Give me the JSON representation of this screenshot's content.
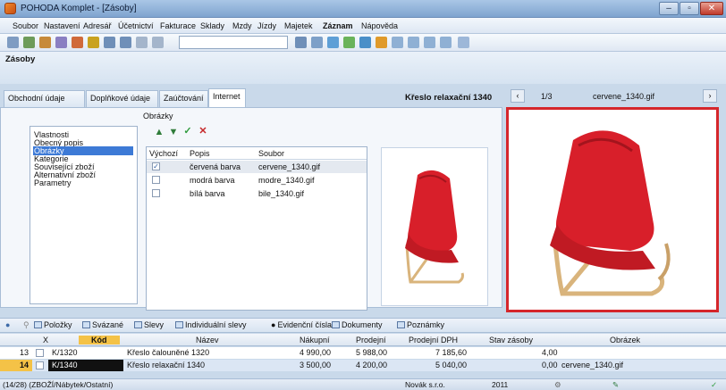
{
  "window": {
    "title": "POHODA Komplet - [Zásoby]",
    "controls": [
      "minimize-icon",
      "maximize-icon",
      "close-icon"
    ]
  },
  "menu": [
    "Soubor",
    "Nastavení",
    "Adresář",
    "Účetnictví",
    "Fakturace",
    "Sklady",
    "Mzdy",
    "Jízdy",
    "Majetek",
    "Záznam",
    "Nápověda"
  ],
  "section": {
    "title": "Zásoby"
  },
  "tabs": [
    "Obchodní údaje",
    "Doplňkové údaje",
    "Zaúčtování",
    "Internet"
  ],
  "active_tab": "Internet",
  "product": {
    "name": "Křeslo relaxační 1340",
    "position": "1/3",
    "file": "cervene_1340.gif"
  },
  "left_list": {
    "items": [
      "Vlastnosti",
      "Obecný popis",
      "Obrázky",
      "Kategorie",
      "Související zboží",
      "Alternativní zboží",
      "Parametry"
    ],
    "selected": "Obrázky"
  },
  "images_group": {
    "label": "Obrázky",
    "toolbar_icons": [
      "arrow-up-icon",
      "arrow-down-icon",
      "check-icon",
      "delete-icon"
    ],
    "columns": [
      "Výchozí",
      "Popis",
      "Soubor"
    ],
    "rows": [
      {
        "default": true,
        "description": "červená barva",
        "file": "cervene_1340.gif"
      },
      {
        "default": false,
        "description": "modrá barva",
        "file": "modre_1340.gif"
      },
      {
        "default": false,
        "description": "bílá barva",
        "file": "bile_1340.gif"
      }
    ]
  },
  "bottom_tabs": [
    "Položky",
    "Svázané",
    "Slevy",
    "Individuální slevy",
    "Evidenční čísla",
    "Dokumenty",
    "Poznámky"
  ],
  "grid": {
    "columns": [
      "X",
      "Kód",
      "Název",
      "Nákupní",
      "Prodejní",
      "Prodejní DPH",
      "Stav zásoby",
      "Obrázek"
    ],
    "rows": [
      {
        "num": "13",
        "code": "K/1320",
        "name": "Křeslo čalouněné 1320",
        "purchase": "4 990,00",
        "sale": "5 988,00",
        "sale_vat": "7 185,60",
        "stock": "4,00",
        "image": ""
      },
      {
        "num": "14",
        "code": "K/1340",
        "name": "Křeslo relaxační 1340",
        "purchase": "3 500,00",
        "sale": "4 200,00",
        "sale_vat": "5 040,00",
        "stock": "0,00",
        "image": "cervene_1340.gif"
      }
    ]
  },
  "status": {
    "path": "(14/28) (ZBOŽÍ/Nábytek/Ostatní)",
    "company": "Novák s.r.o.",
    "year": "2011"
  },
  "colors": {
    "accent": "#3d7ad6",
    "preview_border": "#d5262b",
    "chair_red": "#d81f2a",
    "wood": "#d9b47c"
  }
}
